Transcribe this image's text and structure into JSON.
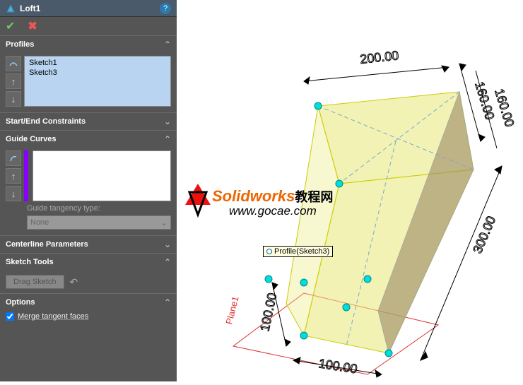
{
  "feature": {
    "title": "Loft1"
  },
  "sections": {
    "profiles": {
      "label": "Profiles",
      "items": [
        "Sketch1",
        "Sketch3"
      ]
    },
    "constraints": {
      "label": "Start/End Constraints"
    },
    "guide_curves": {
      "label": "Guide Curves",
      "tangency_label": "Guide tangency type:",
      "tangency_value": "None"
    },
    "centerline": {
      "label": "Centerline Parameters"
    },
    "sketch_tools": {
      "label": "Sketch Tools",
      "drag_label": "Drag Sketch"
    },
    "options": {
      "label": "Options",
      "merge_label": "Merge tangent faces",
      "merge_checked": true
    }
  },
  "viewport": {
    "dims": {
      "top_width": "200.00",
      "top_depth_a": "160.00",
      "top_depth_b": "160.00",
      "height": "300.00",
      "bottom_w": "100.00",
      "bottom_d": "100.00"
    },
    "plane_label": "Plane1",
    "tooltip": "Profile(Sketch3)"
  },
  "watermark": {
    "brand": "Solidworks",
    "cn": "教程网",
    "url": "www.gocae.com"
  }
}
